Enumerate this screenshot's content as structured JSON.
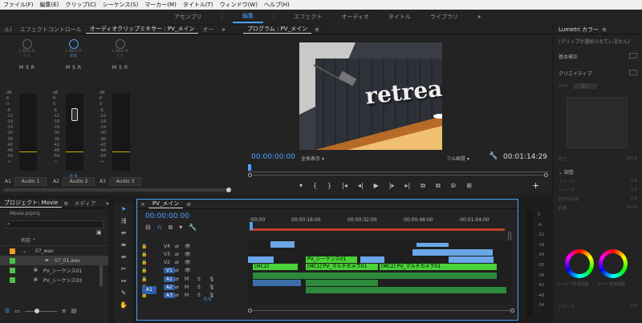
{
  "menu": [
    "ファイル(F)",
    "編集(E)",
    "クリップ(C)",
    "シーケンス(S)",
    "マーカー(M)",
    "タイトル(T)",
    "ウィンドウ(W)",
    "ヘルプ(H)"
  ],
  "workspaces": [
    "アセンブリ",
    "編集",
    "エフェクト",
    "オーディオ",
    "タイトル",
    "ライブラリ"
  ],
  "workspaces_more": "»",
  "effect_panel": {
    "tabs": [
      "ル)",
      "エフェクトコントロール",
      "オーディオクリップミキサー : PV_メイン",
      "オー"
    ],
    "more": "»",
    "channels": [
      {
        "pan_label": "L Rest R",
        "pan_value": "0.0",
        "msr": [
          "M",
          "S",
          "R"
        ],
        "value": "",
        "name": "Audio 1",
        "id": "A1"
      },
      {
        "pan_label": "L Rest R",
        "pan_value": "0.0",
        "msr": [
          "M",
          "S",
          "R"
        ],
        "value": "0.0",
        "name": "Audio 2",
        "id": "A2"
      },
      {
        "pan_label": "L Rest R",
        "pan_value": "0.0",
        "msr": [
          "M",
          "S",
          "R"
        ],
        "value": "",
        "name": "Audio 3",
        "id": "A3"
      }
    ],
    "db_scale": [
      "dB",
      "6",
      "0",
      "-6",
      "-12",
      "-18",
      "-24",
      "-30",
      "-36",
      "-42",
      "-48",
      "-54",
      "-∞"
    ]
  },
  "program": {
    "title": "プログラム : PV_メイン",
    "sign_text": "retreat",
    "timecode": "00:00:00:00",
    "zoom": "全体表示",
    "quality": "フル画質",
    "duration": "00:01:14:29",
    "transport": [
      "▾",
      "{",
      "}",
      "|◂",
      "◂|",
      "▶",
      "|▸",
      "▸|",
      "⧉",
      "⧉",
      "⦾",
      "⊞"
    ],
    "add": "+"
  },
  "lumetri": {
    "title": "Lumetri カラー",
    "no_clip": "(クリップが選択されていません)",
    "basic": "基本補正",
    "creative": "クリエイティブ",
    "look": "Look",
    "look_value": "なし",
    "intensity": "強さ",
    "intensity_value": "100.0",
    "adjust": "調整",
    "params": [
      {
        "name": "フェード",
        "value": "0.0"
      },
      {
        "name": "シャープ",
        "value": "0.0"
      },
      {
        "name": "自然な彩度",
        "value": "0.0"
      },
      {
        "name": "彩度",
        "value": "100.0"
      }
    ],
    "shadow_tint": "シャドウ色相調整",
    "highlight_tint": "ライト色相調整",
    "balance": "バランス",
    "balance_value": "0.0"
  },
  "project": {
    "tabs": [
      "プロジェクト: Movie",
      "メディア"
    ],
    "more": "»",
    "filename": "Movie.prproj",
    "col_name": "名前",
    "items": [
      {
        "name": "07_wav",
        "indent": 1,
        "color": "#f0a020"
      },
      {
        "name": "07_01.wav",
        "indent": 2,
        "color": "#4ec24e"
      },
      {
        "name": "PV_シーケンス01",
        "indent": 1,
        "color": "#4ec24e"
      },
      {
        "name": "PV_シーケンス03",
        "indent": 1,
        "color": "#4ec24e"
      }
    ]
  },
  "timeline": {
    "tab": "PV_メイン",
    "timecode": "00:00:00:00",
    "ruler": [
      ":00:00",
      "00:00:16:00",
      "00:00:32:00",
      "00:00:48:00",
      "00:01:04:00"
    ],
    "video_tracks": [
      "V4",
      "V3",
      "V2",
      "V1"
    ],
    "audio_tracks": [
      "A1",
      "A2",
      "A3"
    ],
    "source_patch": "A1",
    "audio_value": "0.0",
    "clips": {
      "v2_a": "PV_シーケンス01",
      "v1_mc2a": "[MC2]",
      "v1_mc1": "[MC1] PV_マルチカメラ01",
      "v1_mc2b": "[MC2] PV_マルチカメラ01"
    },
    "db_right": [
      "0",
      "-6",
      "-12",
      "-18",
      "-24",
      "-30",
      "-36",
      "-42",
      "-48",
      "-54"
    ]
  },
  "colors": {
    "accent": "#4ea1ff",
    "clip_green": "#49d138",
    "clip_blue": "#6aa6e8"
  }
}
